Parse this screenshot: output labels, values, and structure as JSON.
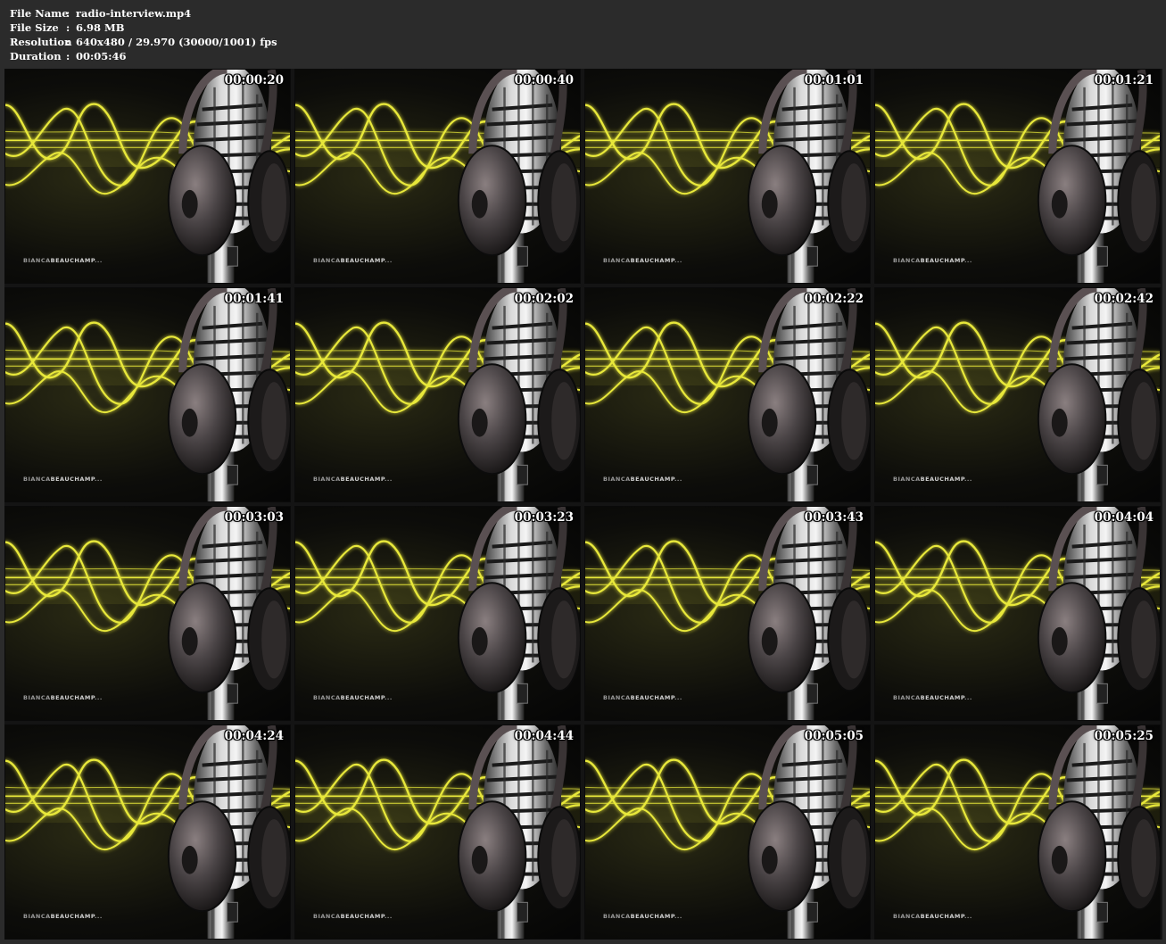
{
  "info": [
    {
      "label": "File Name",
      "value": "radio-interview.mp4"
    },
    {
      "label": "File Size",
      "value": "6.98 MB"
    },
    {
      "label": "Resolution",
      "value": "640x480 / 29.970 (30000/1001) fps"
    },
    {
      "label": "Duration",
      "value": "00:05:46"
    }
  ],
  "separator": ":",
  "watermark": {
    "part1": "BIANCA",
    "part2": "BEAUCHAMP",
    "suffix": "..."
  },
  "thumbnails": [
    "00:00:20",
    "00:00:40",
    "00:01:01",
    "00:01:21",
    "00:01:41",
    "00:02:02",
    "00:02:22",
    "00:02:42",
    "00:03:03",
    "00:03:23",
    "00:03:43",
    "00:04:04",
    "00:04:24",
    "00:04:44",
    "00:05:05",
    "00:05:25"
  ],
  "colors": {
    "wave": "#e8e83a",
    "background": "#2b2b2b"
  }
}
